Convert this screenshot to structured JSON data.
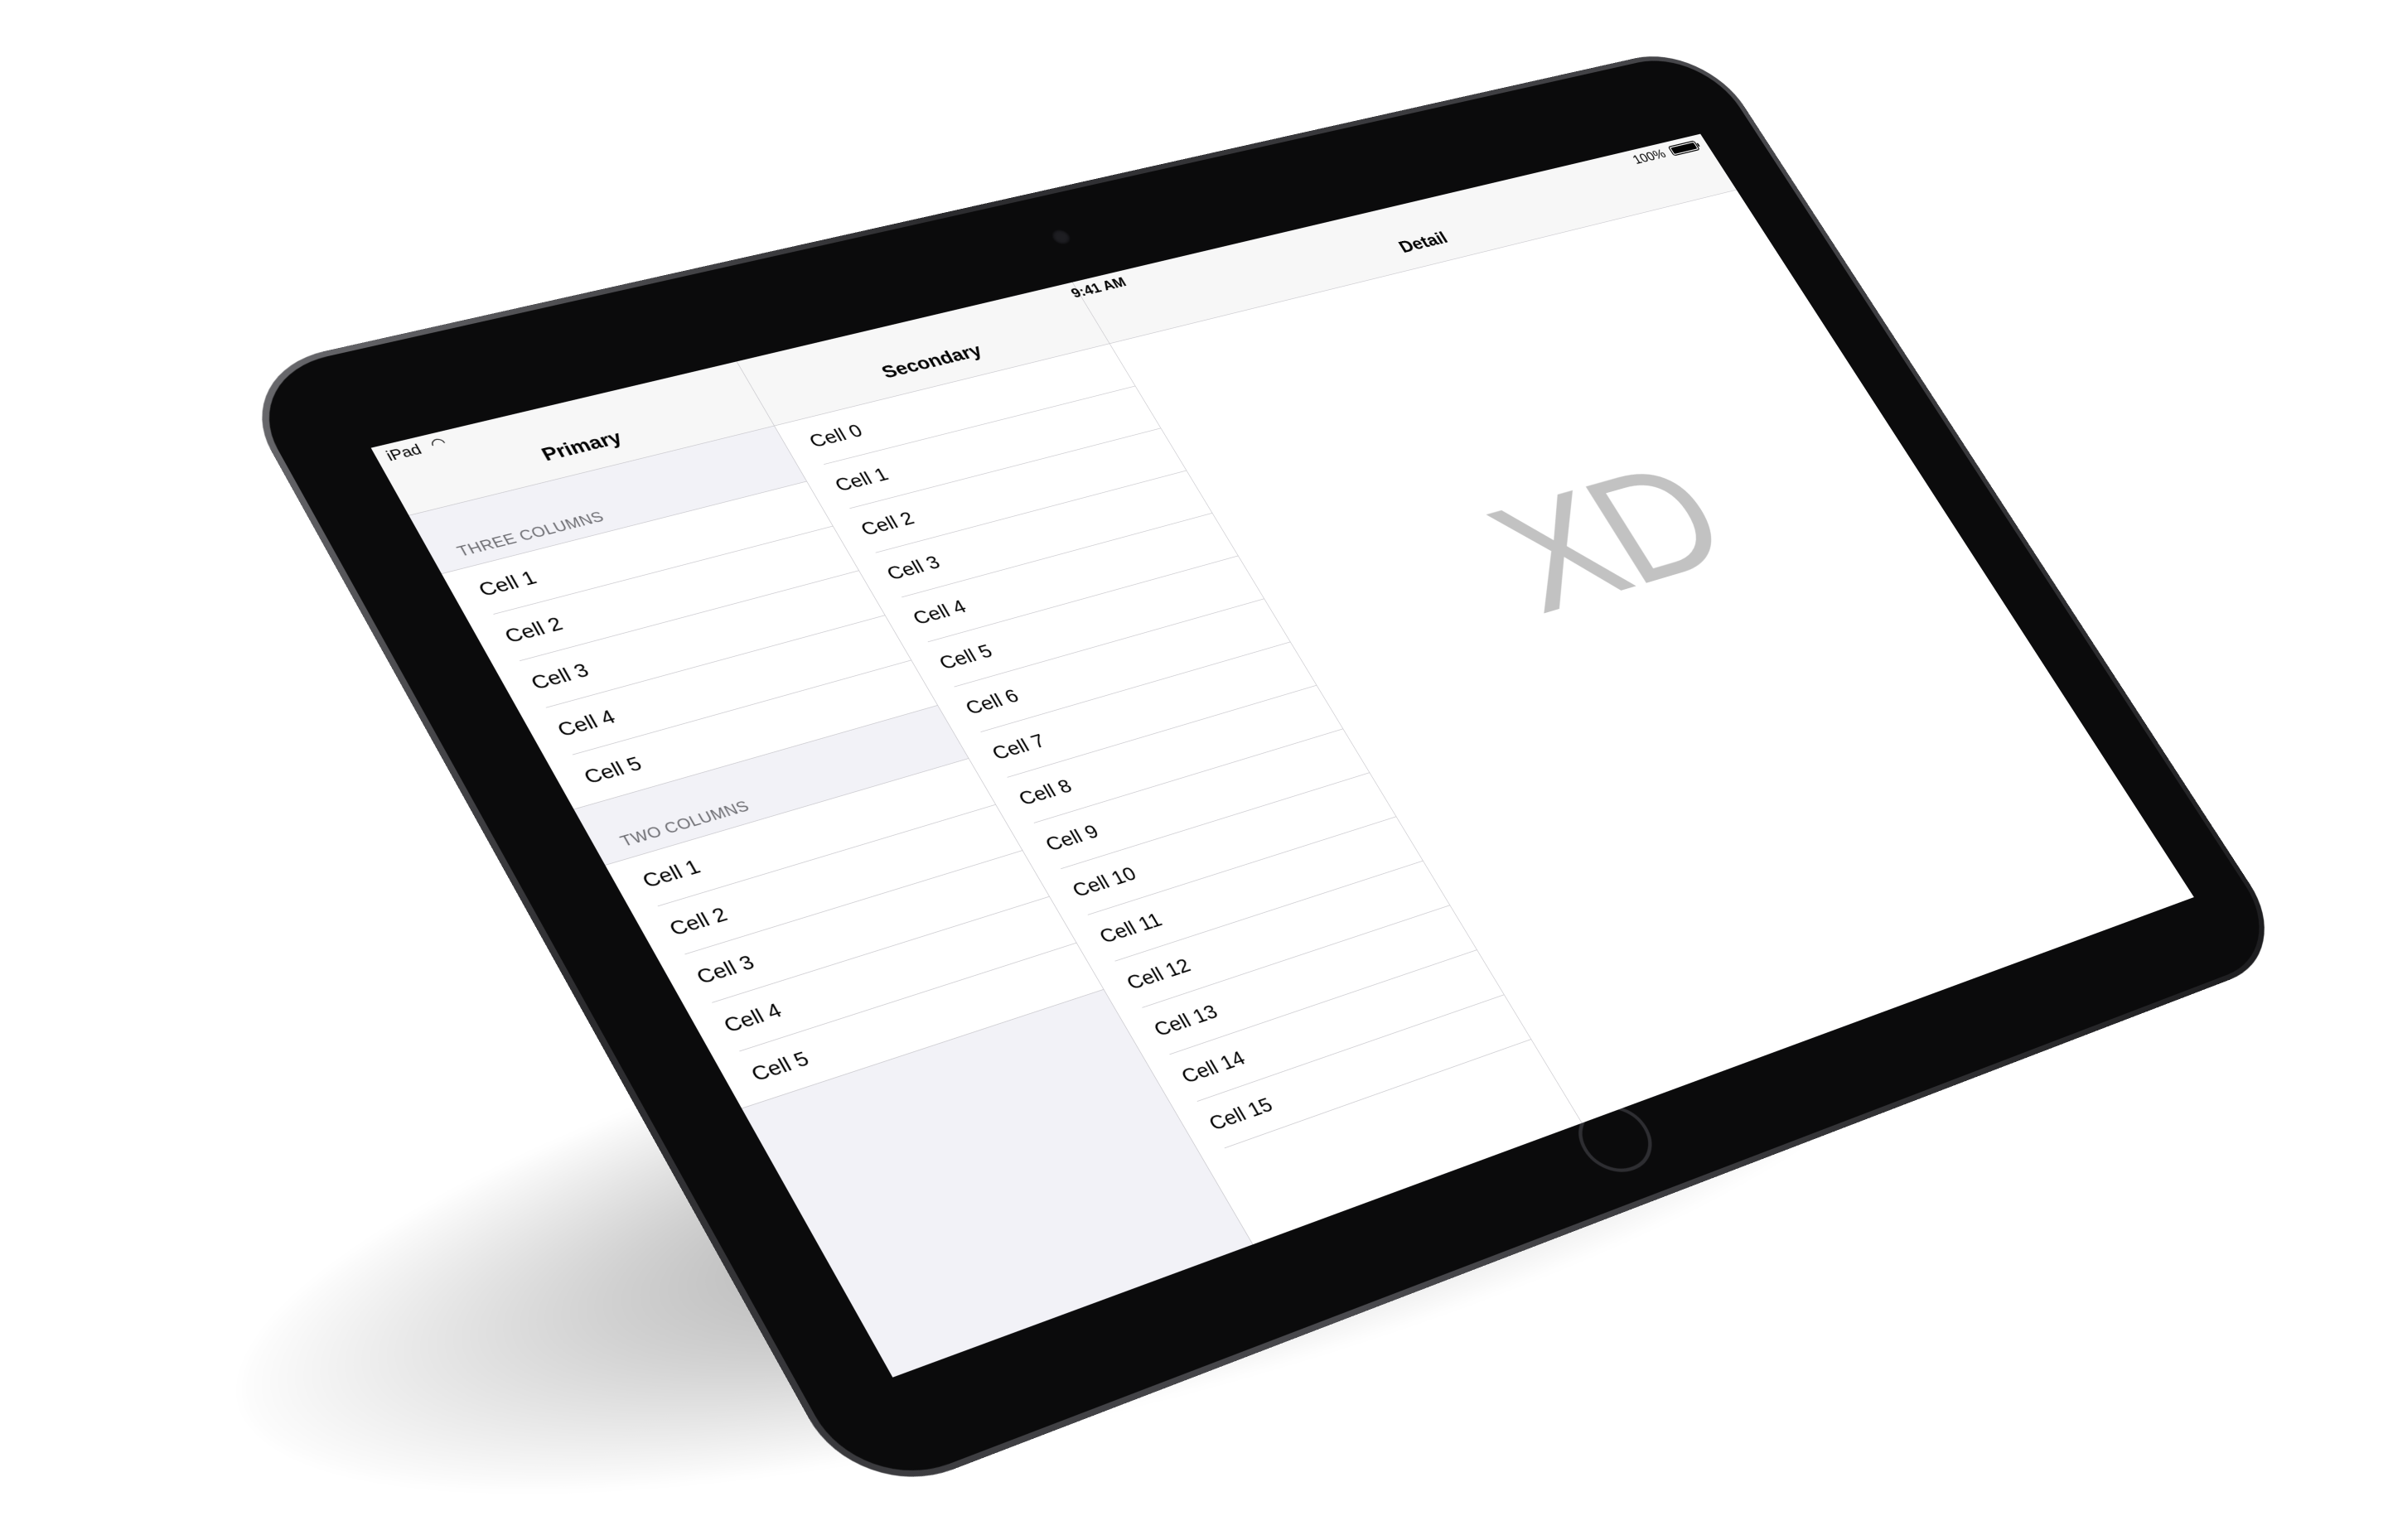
{
  "status_bar": {
    "carrier": "iPad",
    "time": "9:41 AM",
    "battery": "100%"
  },
  "primary": {
    "title": "Primary",
    "sections": [
      {
        "header": "THREE COLUMNS",
        "cells": [
          "Cell 1",
          "Cell 2",
          "Cell 3",
          "Cell 4",
          "Cell 5"
        ]
      },
      {
        "header": "TWO COLUMNS",
        "cells": [
          "Cell 1",
          "Cell 2",
          "Cell 3",
          "Cell 4",
          "Cell 5"
        ]
      }
    ]
  },
  "secondary": {
    "title": "Secondary",
    "cells": [
      "Cell 0",
      "Cell 1",
      "Cell 2",
      "Cell 3",
      "Cell 4",
      "Cell 5",
      "Cell 6",
      "Cell 7",
      "Cell 8",
      "Cell 9",
      "Cell 10",
      "Cell 11",
      "Cell 12",
      "Cell 13",
      "Cell 14",
      "Cell 15"
    ]
  },
  "detail": {
    "title": "Detail",
    "logo_text": "XD"
  },
  "icons": {
    "wifi": "wifi-icon",
    "battery": "battery-icon",
    "home": "home-button-icon",
    "camera": "camera-icon"
  }
}
